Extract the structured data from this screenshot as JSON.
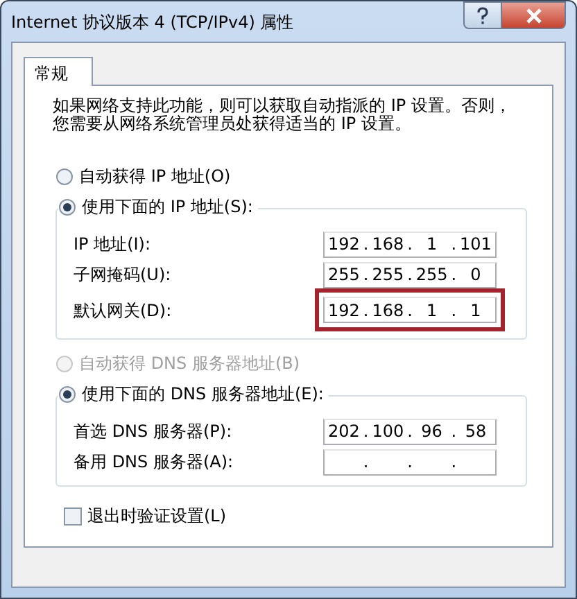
{
  "window": {
    "title": "Internet 协议版本 4 (TCP/IPv4) 属性"
  },
  "tabs": [
    {
      "label": "常规",
      "selected": true
    }
  ],
  "description": "如果网络支持此功能，则可以获取自动指派的 IP 设置。否则，您需要从网络系统管理员处获得适当的 IP 设置。",
  "ip_mode": [
    {
      "label": "自动获得 IP 地址(O)",
      "selected": false,
      "disabled": false
    },
    {
      "label": "使用下面的 IP 地址(S):",
      "selected": true,
      "disabled": false
    }
  ],
  "ip_fields": [
    {
      "label": "IP 地址(I):",
      "octets": [
        "192",
        "168",
        "1",
        "101"
      ],
      "separator": ".",
      "highlighted": false
    },
    {
      "label": "子网掩码(U):",
      "octets": [
        "255",
        "255",
        "255",
        "0"
      ],
      "separator": ".",
      "highlighted": false
    },
    {
      "label": "默认网关(D):",
      "octets": [
        "192",
        "168",
        "1",
        "1"
      ],
      "separator": ".",
      "highlighted": true
    }
  ],
  "dns_mode": [
    {
      "label": "自动获得 DNS 服务器地址(B)",
      "selected": false,
      "disabled": true
    },
    {
      "label": "使用下面的 DNS 服务器地址(E):",
      "selected": true,
      "disabled": false
    }
  ],
  "dns_fields": [
    {
      "label": "首选 DNS 服务器(P):",
      "octets": [
        "202",
        "100",
        "96",
        "58"
      ],
      "separator": ".",
      "highlighted": false
    },
    {
      "label": "备用 DNS 服务器(A):",
      "separator": ".",
      "highlighted": false
    }
  ],
  "validate_on_exit": {
    "label": "退出时验证设置(L)",
    "checked": false
  }
}
